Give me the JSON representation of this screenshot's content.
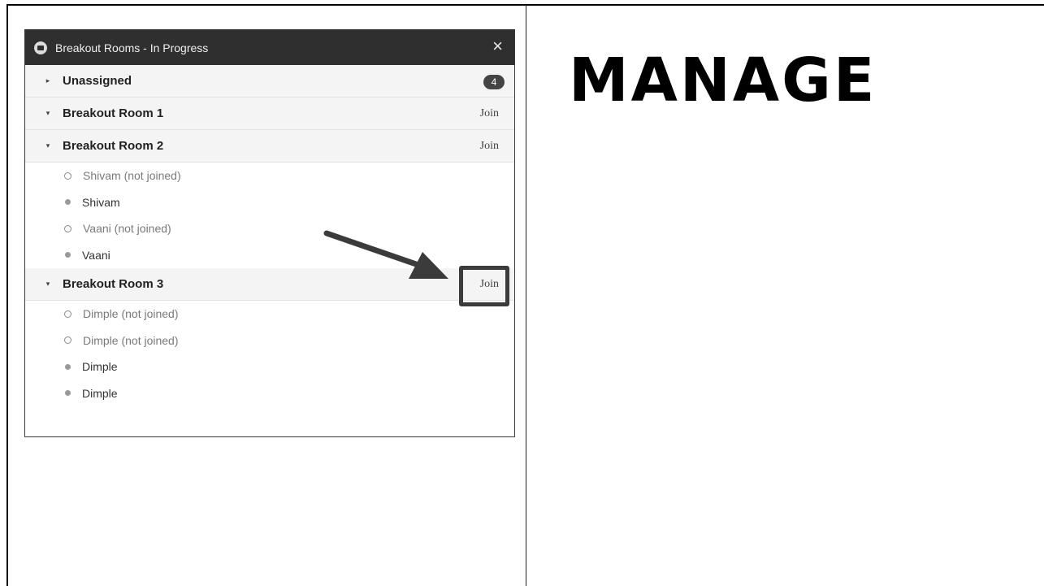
{
  "slide": {
    "heading": "MANAGE"
  },
  "window": {
    "title": "Breakout Rooms - In Progress",
    "close_label": "×",
    "rooms": [
      {
        "name": "Unassigned",
        "badge": "4"
      },
      {
        "name": "Breakout Room 1",
        "join": "Join"
      },
      {
        "name": "Breakout Room 2",
        "join": "Join",
        "members": [
          {
            "name": "Shivam (not joined)",
            "joined": false
          },
          {
            "name": "Shivam",
            "joined": true
          },
          {
            "name": "Vaani (not joined)",
            "joined": false
          },
          {
            "name": "Vaani",
            "joined": true
          }
        ]
      },
      {
        "name": "Breakout Room 3",
        "join": "Join",
        "members": [
          {
            "name": "Dimple (not joined)",
            "joined": false
          },
          {
            "name": "Dimple (not joined)",
            "joined": false
          },
          {
            "name": "Dimple",
            "joined": true
          },
          {
            "name": "Dimple",
            "joined": true
          }
        ]
      }
    ]
  },
  "icons": {
    "collapsed": "▸",
    "expanded": "▾"
  },
  "colors": {
    "titlebar": "#2f2f2f",
    "room_row": "#f4f4f4",
    "annotation": "#3b3b3b"
  }
}
